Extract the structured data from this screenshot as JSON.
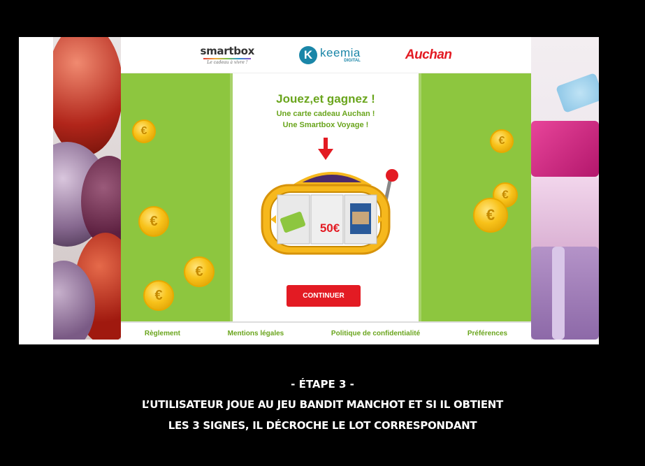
{
  "logos": {
    "smartbox_name": "smartbox",
    "smartbox_tagline": "Le cadeau à vivre !",
    "keemia_name": "keemia",
    "keemia_sub": "DIGITAL",
    "auchan_name": "Auchan"
  },
  "game": {
    "title": "Jouez,et gagnez  !",
    "line1": "Une carte cadeau Auchan !",
    "line2": "Une Smartbox Voyage !",
    "reel_value": "50€",
    "continue_label": "CONTINUER"
  },
  "footer": {
    "links": [
      "Règlement",
      "Mentions légales",
      "Politique de confidentialité",
      "Préférences"
    ]
  },
  "caption": {
    "step": "- ÉTAPE 3 -",
    "line1": "L’UTILISATEUR JOUE AU JEU BANDIT MANCHOT ET SI IL OBTIENT",
    "line2": "LES 3 SIGNES, IL DÉCROCHE LE LOT CORRESPONDANT"
  },
  "colors": {
    "brand_green": "#8dc63f",
    "text_green": "#6aa51d",
    "auchan_red": "#e31b23",
    "background": "#000000"
  },
  "icons": [
    "down-arrow-icon",
    "euro-coin-icon",
    "slot-machine-icon",
    "sparkle-icon"
  ]
}
